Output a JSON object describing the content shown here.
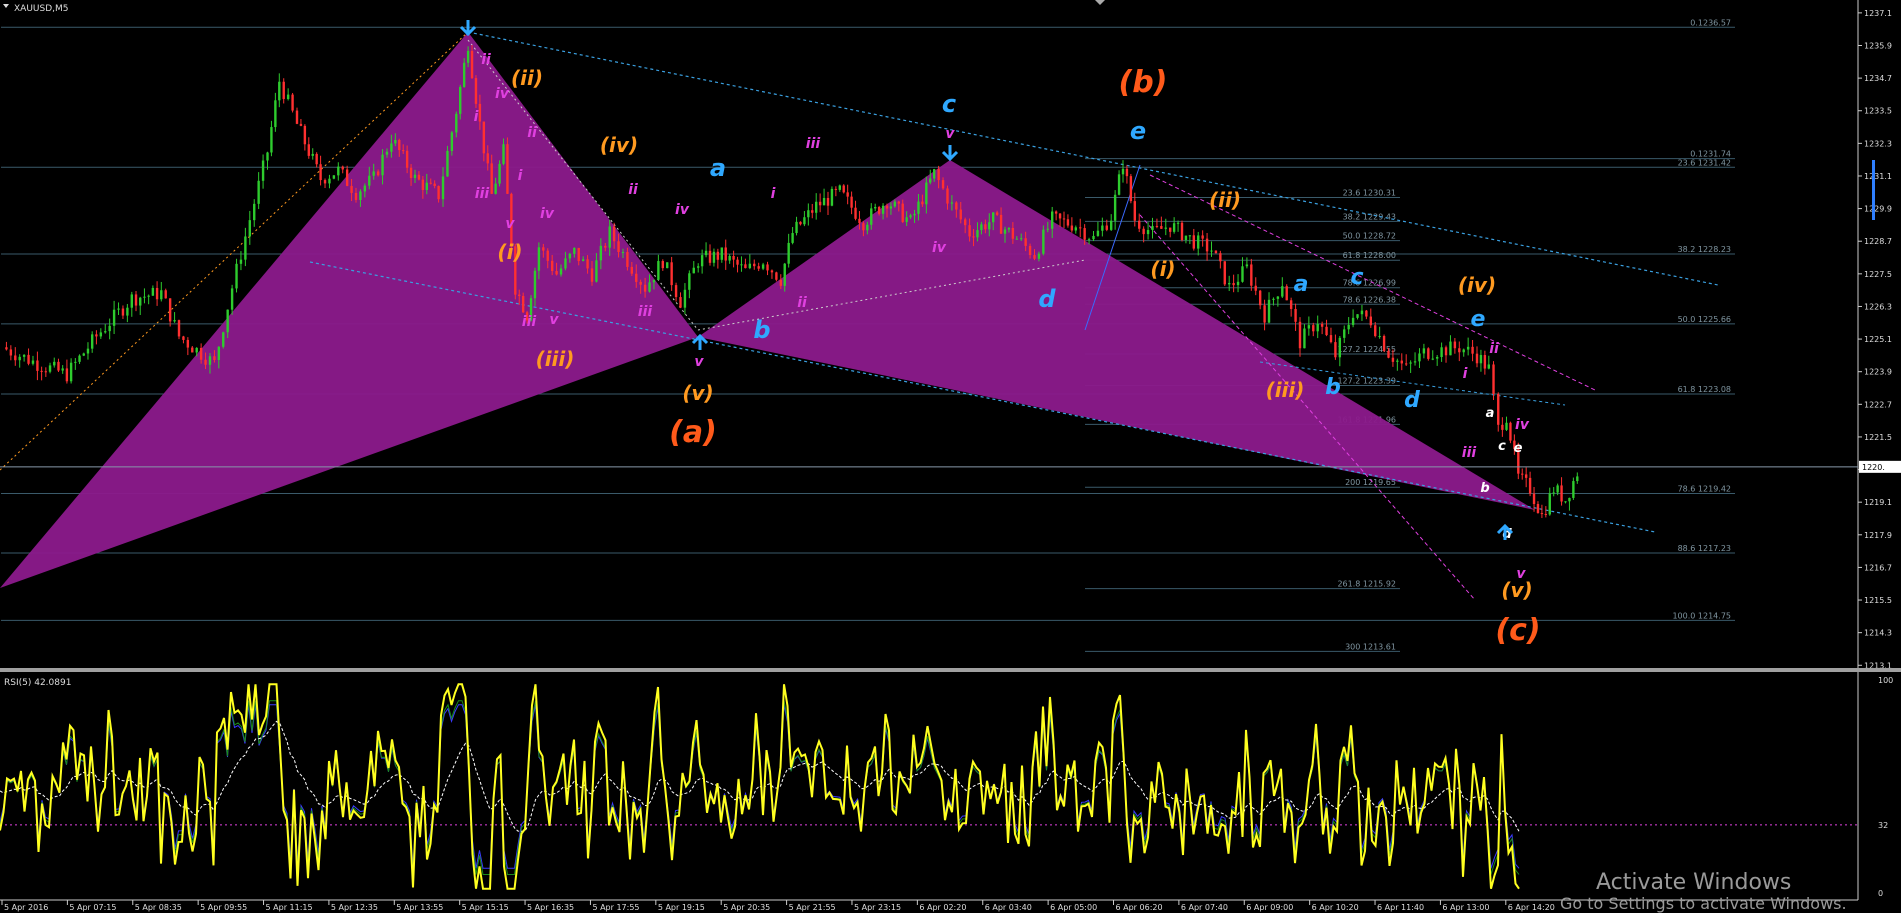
{
  "window": {
    "symbol_label": "XAUUSD,M5",
    "rsi_label": "RSI(5) 42.0891"
  },
  "colors": {
    "bull": "#2ecc2e",
    "bear": "#ff3030",
    "pattern": "#8c1a8c",
    "channel": "#3aa0e0",
    "rsi": "#ffff20",
    "fib": "#3a5a6a",
    "orange": "#ff9a20",
    "red_orange": "#ff5a1a",
    "cyan": "#2fa8ff",
    "magenta": "#e040e0",
    "white": "#ffffff"
  },
  "chart_data": {
    "type": "candlestick",
    "symbol": "XAUUSD",
    "timeframe": "M5",
    "ylim": [
      1213,
      1237.5
    ],
    "y_ticks": [
      1213.1,
      1214.3,
      1215.5,
      1216.7,
      1217.9,
      1219.1,
      1220.3,
      1221.5,
      1222.7,
      1223.9,
      1225.1,
      1226.3,
      1227.5,
      1228.7,
      1229.9,
      1231.1,
      1232.3,
      1233.5,
      1234.7,
      1235.9,
      1237.1
    ],
    "y_tick_labels": [
      "1213.1",
      "1214.3",
      "1215.5",
      "1216.7",
      "1217.9",
      "1219.1",
      "1220.3",
      "1221.5",
      "1222.7",
      "1223.9",
      "1225.1",
      "1226.3",
      "1227.5",
      "1228.7",
      "1229.9",
      "1231.1",
      "1232.3",
      "1233.5",
      "1234.7",
      "1235.9",
      "1237.1"
    ],
    "current_price_label": "1220.",
    "current_price": 1220.4,
    "x_labels": [
      "5 Apr 2016",
      "5 Apr 07:15",
      "5 Apr 08:35",
      "5 Apr 09:55",
      "5 Apr 11:15",
      "5 Apr 12:35",
      "5 Apr 13:55",
      "5 Apr 15:15",
      "5 Apr 16:35",
      "5 Apr 17:55",
      "5 Apr 19:15",
      "5 Apr 20:35",
      "5 Apr 21:55",
      "5 Apr 23:15",
      "6 Apr 02:20",
      "6 Apr 03:40",
      "6 Apr 05:00",
      "6 Apr 06:20",
      "6 Apr 07:40",
      "6 Apr 09:00",
      "6 Apr 10:20",
      "6 Apr 11:40",
      "6 Apr 13:00",
      "6 Apr 14:20"
    ],
    "price_path": [
      [
        0,
        1224.8
      ],
      [
        30,
        1224.2
      ],
      [
        55,
        1223.8
      ],
      [
        80,
        1225.2
      ],
      [
        110,
        1226.6
      ],
      [
        135,
        1226.8
      ],
      [
        150,
        1225.2
      ],
      [
        180,
        1224.2
      ],
      [
        195,
        1227.0
      ],
      [
        210,
        1229.5
      ],
      [
        225,
        1232.0
      ],
      [
        235,
        1234.6
      ],
      [
        250,
        1233.0
      ],
      [
        270,
        1231.0
      ],
      [
        285,
        1231.3
      ],
      [
        300,
        1230.5
      ],
      [
        315,
        1231.0
      ],
      [
        330,
        1232.5
      ],
      [
        350,
        1231.0
      ],
      [
        370,
        1230.4
      ],
      [
        385,
        1233.5
      ],
      [
        395,
        1236.0
      ],
      [
        405,
        1233.0
      ],
      [
        415,
        1230.4
      ],
      [
        425,
        1232.0
      ],
      [
        435,
        1227.0
      ],
      [
        445,
        1226.0
      ],
      [
        455,
        1228.5
      ],
      [
        470,
        1227.5
      ],
      [
        485,
        1228.3
      ],
      [
        500,
        1227.5
      ],
      [
        515,
        1229.0
      ],
      [
        530,
        1228.0
      ],
      [
        545,
        1227.0
      ],
      [
        560,
        1228.0
      ],
      [
        575,
        1226.5
      ],
      [
        590,
        1228.0
      ],
      [
        610,
        1228.2
      ],
      [
        630,
        1227.6
      ],
      [
        645,
        1228.0
      ],
      [
        660,
        1227.3
      ],
      [
        670,
        1229.0
      ],
      [
        690,
        1230.0
      ],
      [
        710,
        1230.5
      ],
      [
        730,
        1229.4
      ],
      [
        750,
        1230.2
      ],
      [
        770,
        1229.4
      ],
      [
        790,
        1231.2
      ],
      [
        805,
        1230.0
      ],
      [
        820,
        1229.0
      ],
      [
        840,
        1229.5
      ],
      [
        860,
        1228.8
      ],
      [
        875,
        1228.2
      ],
      [
        890,
        1229.5
      ],
      [
        910,
        1229.3
      ],
      [
        925,
        1228.8
      ],
      [
        940,
        1229.6
      ],
      [
        950,
        1231.6
      ],
      [
        960,
        1229.5
      ],
      [
        975,
        1229.0
      ],
      [
        990,
        1229.3
      ],
      [
        1010,
        1228.7
      ],
      [
        1025,
        1228.4
      ],
      [
        1040,
        1227.0
      ],
      [
        1055,
        1227.7
      ],
      [
        1070,
        1226.0
      ],
      [
        1085,
        1227.2
      ],
      [
        1100,
        1225.0
      ],
      [
        1115,
        1225.8
      ],
      [
        1130,
        1224.5
      ],
      [
        1145,
        1226.1
      ],
      [
        1160,
        1225.8
      ],
      [
        1175,
        1224.6
      ],
      [
        1190,
        1224.0
      ],
      [
        1205,
        1224.6
      ],
      [
        1220,
        1224.7
      ],
      [
        1235,
        1224.8
      ],
      [
        1250,
        1224.5
      ],
      [
        1260,
        1224.0
      ],
      [
        1268,
        1221.8
      ],
      [
        1275,
        1222.3
      ],
      [
        1285,
        1220.0
      ],
      [
        1295,
        1219.6
      ],
      [
        1305,
        1218.6
      ],
      [
        1315,
        1219.6
      ],
      [
        1325,
        1219.2
      ],
      [
        1335,
        1220.2
      ]
    ],
    "fib_levels": [
      {
        "label": "0.1236.57",
        "price": 1236.57,
        "x1": 1,
        "x2": 1735
      },
      {
        "label": "0.1231.74",
        "price": 1231.74,
        "x1": 1085,
        "x2": 1735
      },
      {
        "label": "23.6 1231.42",
        "price": 1231.42,
        "x1": 1,
        "x2": 1735
      },
      {
        "label": "23.6 1230.31",
        "price": 1230.31,
        "x1": 1085,
        "x2": 1400
      },
      {
        "label": "38.2 1229.43",
        "price": 1229.43,
        "x1": 1085,
        "x2": 1400
      },
      {
        "label": "50.0 1228.72",
        "price": 1228.72,
        "x1": 1085,
        "x2": 1400
      },
      {
        "label": "38.2 1228.23",
        "price": 1228.23,
        "x1": 1,
        "x2": 1735
      },
      {
        "label": "61.8 1228.00",
        "price": 1228.0,
        "x1": 1085,
        "x2": 1400
      },
      {
        "label": "78.6 1226.99",
        "price": 1226.99,
        "x1": 1085,
        "x2": 1400
      },
      {
        "label": "78.6 1226.38",
        "price": 1226.38,
        "x1": 1085,
        "x2": 1400
      },
      {
        "label": "50.0 1225.66",
        "price": 1225.66,
        "x1": 1,
        "x2": 1735
      },
      {
        "label": "127.2 1224.55",
        "price": 1224.55,
        "x1": 1085,
        "x2": 1400
      },
      {
        "label": "127.2 1223.39",
        "price": 1223.39,
        "x1": 1085,
        "x2": 1400
      },
      {
        "label": "61.8 1223.08",
        "price": 1223.08,
        "x1": 1,
        "x2": 1735
      },
      {
        "label": "161.8 1221.96",
        "price": 1221.96,
        "x1": 1085,
        "x2": 1400
      },
      {
        "label": "200 1219.65",
        "price": 1219.65,
        "x1": 1085,
        "x2": 1400
      },
      {
        "label": "78.6 1219.42",
        "price": 1219.42,
        "x1": 1,
        "x2": 1735
      },
      {
        "label": "88.6 1217.23",
        "price": 1217.23,
        "x1": 1,
        "x2": 1735
      },
      {
        "label": "261.8 1215.92",
        "price": 1215.92,
        "x1": 1085,
        "x2": 1400
      },
      {
        "label": "100.0 1214.75",
        "price": 1214.75,
        "x1": 1,
        "x2": 1735
      },
      {
        "label": "300 1213.61",
        "price": 1213.61,
        "x1": 1085,
        "x2": 1400
      }
    ],
    "rsi": {
      "name": "RSI(5)",
      "current": 42.0891,
      "ylim": [
        0,
        100
      ],
      "levels": [
        100,
        32,
        0
      ],
      "level_labels": [
        "100",
        "32",
        "0"
      ]
    },
    "wave_labels": [
      {
        "text": "(a)",
        "x": 693,
        "y": 442,
        "color": "red_orange",
        "size": 30
      },
      {
        "text": "(b)",
        "x": 1143,
        "y": 92,
        "color": "red_orange",
        "size": 30
      },
      {
        "text": "(c)",
        "x": 1518,
        "y": 640,
        "color": "red_orange",
        "size": 30
      },
      {
        "text": "(i)",
        "x": 510,
        "y": 259,
        "color": "orange",
        "size": 20
      },
      {
        "text": "(ii)",
        "x": 527,
        "y": 85,
        "color": "orange",
        "size": 20
      },
      {
        "text": "(iii)",
        "x": 555,
        "y": 366,
        "color": "orange",
        "size": 20
      },
      {
        "text": "(iv)",
        "x": 619,
        "y": 152,
        "color": "orange",
        "size": 20
      },
      {
        "text": "(v)",
        "x": 698,
        "y": 400,
        "color": "orange",
        "size": 20
      },
      {
        "text": "(i)",
        "x": 1163,
        "y": 276,
        "color": "orange",
        "size": 20
      },
      {
        "text": "(ii)",
        "x": 1225,
        "y": 207,
        "color": "orange",
        "size": 20
      },
      {
        "text": "(iii)",
        "x": 1285,
        "y": 397,
        "color": "orange",
        "size": 20
      },
      {
        "text": "(iv)",
        "x": 1477,
        "y": 292,
        "color": "orange",
        "size": 20
      },
      {
        "text": "(v)",
        "x": 1517,
        "y": 597,
        "color": "orange",
        "size": 20
      },
      {
        "text": "a",
        "x": 718,
        "y": 176,
        "color": "cyan",
        "size": 24
      },
      {
        "text": "b",
        "x": 762,
        "y": 338,
        "color": "cyan",
        "size": 24
      },
      {
        "text": "c",
        "x": 949,
        "y": 112,
        "color": "cyan",
        "size": 24
      },
      {
        "text": "d",
        "x": 1047,
        "y": 307,
        "color": "cyan",
        "size": 24
      },
      {
        "text": "e",
        "x": 1138,
        "y": 139,
        "color": "cyan",
        "size": 24
      },
      {
        "text": "a",
        "x": 1301,
        "y": 291,
        "color": "cyan",
        "size": 22
      },
      {
        "text": "b",
        "x": 1333,
        "y": 394,
        "color": "cyan",
        "size": 22
      },
      {
        "text": "c",
        "x": 1357,
        "y": 284,
        "color": "cyan",
        "size": 22
      },
      {
        "text": "d",
        "x": 1412,
        "y": 407,
        "color": "cyan",
        "size": 22
      },
      {
        "text": "e",
        "x": 1478,
        "y": 326,
        "color": "cyan",
        "size": 22
      },
      {
        "text": "ii",
        "x": 486,
        "y": 64,
        "color": "magenta",
        "size": 14
      },
      {
        "text": "iv",
        "x": 502,
        "y": 98,
        "color": "magenta",
        "size": 14
      },
      {
        "text": "i",
        "x": 476,
        "y": 121,
        "color": "magenta",
        "size": 14
      },
      {
        "text": "ii",
        "x": 532,
        "y": 137,
        "color": "magenta",
        "size": 14
      },
      {
        "text": "i",
        "x": 520,
        "y": 180,
        "color": "magenta",
        "size": 14
      },
      {
        "text": "iii",
        "x": 482,
        "y": 198,
        "color": "magenta",
        "size": 14
      },
      {
        "text": "iv",
        "x": 547,
        "y": 218,
        "color": "magenta",
        "size": 14
      },
      {
        "text": "v",
        "x": 510,
        "y": 228,
        "color": "magenta",
        "size": 14
      },
      {
        "text": "iii",
        "x": 529,
        "y": 326,
        "color": "magenta",
        "size": 14
      },
      {
        "text": "v",
        "x": 554,
        "y": 324,
        "color": "magenta",
        "size": 14
      },
      {
        "text": "ii",
        "x": 633,
        "y": 194,
        "color": "magenta",
        "size": 14
      },
      {
        "text": "iii",
        "x": 645,
        "y": 316,
        "color": "magenta",
        "size": 14
      },
      {
        "text": "iv",
        "x": 682,
        "y": 214,
        "color": "magenta",
        "size": 14
      },
      {
        "text": "iii",
        "x": 813,
        "y": 148,
        "color": "magenta",
        "size": 14
      },
      {
        "text": "i",
        "x": 773,
        "y": 198,
        "color": "magenta",
        "size": 14
      },
      {
        "text": "ii",
        "x": 802,
        "y": 307,
        "color": "magenta",
        "size": 14
      },
      {
        "text": "v",
        "x": 699,
        "y": 366,
        "color": "magenta",
        "size": 14
      },
      {
        "text": "v",
        "x": 950,
        "y": 138,
        "color": "magenta",
        "size": 14
      },
      {
        "text": "iv",
        "x": 939,
        "y": 252,
        "color": "magenta",
        "size": 14
      },
      {
        "text": "ii",
        "x": 1494,
        "y": 353,
        "color": "magenta",
        "size": 14
      },
      {
        "text": "i",
        "x": 1465,
        "y": 378,
        "color": "magenta",
        "size": 14
      },
      {
        "text": "iii",
        "x": 1469,
        "y": 457,
        "color": "magenta",
        "size": 14
      },
      {
        "text": "iv",
        "x": 1522,
        "y": 429,
        "color": "magenta",
        "size": 14
      },
      {
        "text": "v",
        "x": 1521,
        "y": 578,
        "color": "magenta",
        "size": 14
      },
      {
        "text": "a",
        "x": 1490,
        "y": 417,
        "color": "white",
        "size": 13
      },
      {
        "text": "c",
        "x": 1502,
        "y": 450,
        "color": "white",
        "size": 13
      },
      {
        "text": "e",
        "x": 1518,
        "y": 452,
        "color": "white",
        "size": 13
      },
      {
        "text": "b",
        "x": 1485,
        "y": 492,
        "color": "white",
        "size": 13
      },
      {
        "text": "d",
        "x": 1507,
        "y": 538,
        "color": "white",
        "size": 13
      }
    ]
  },
  "watermark": {
    "line1": "Activate Windows",
    "line2": "Go to Settings to activate Windows."
  }
}
